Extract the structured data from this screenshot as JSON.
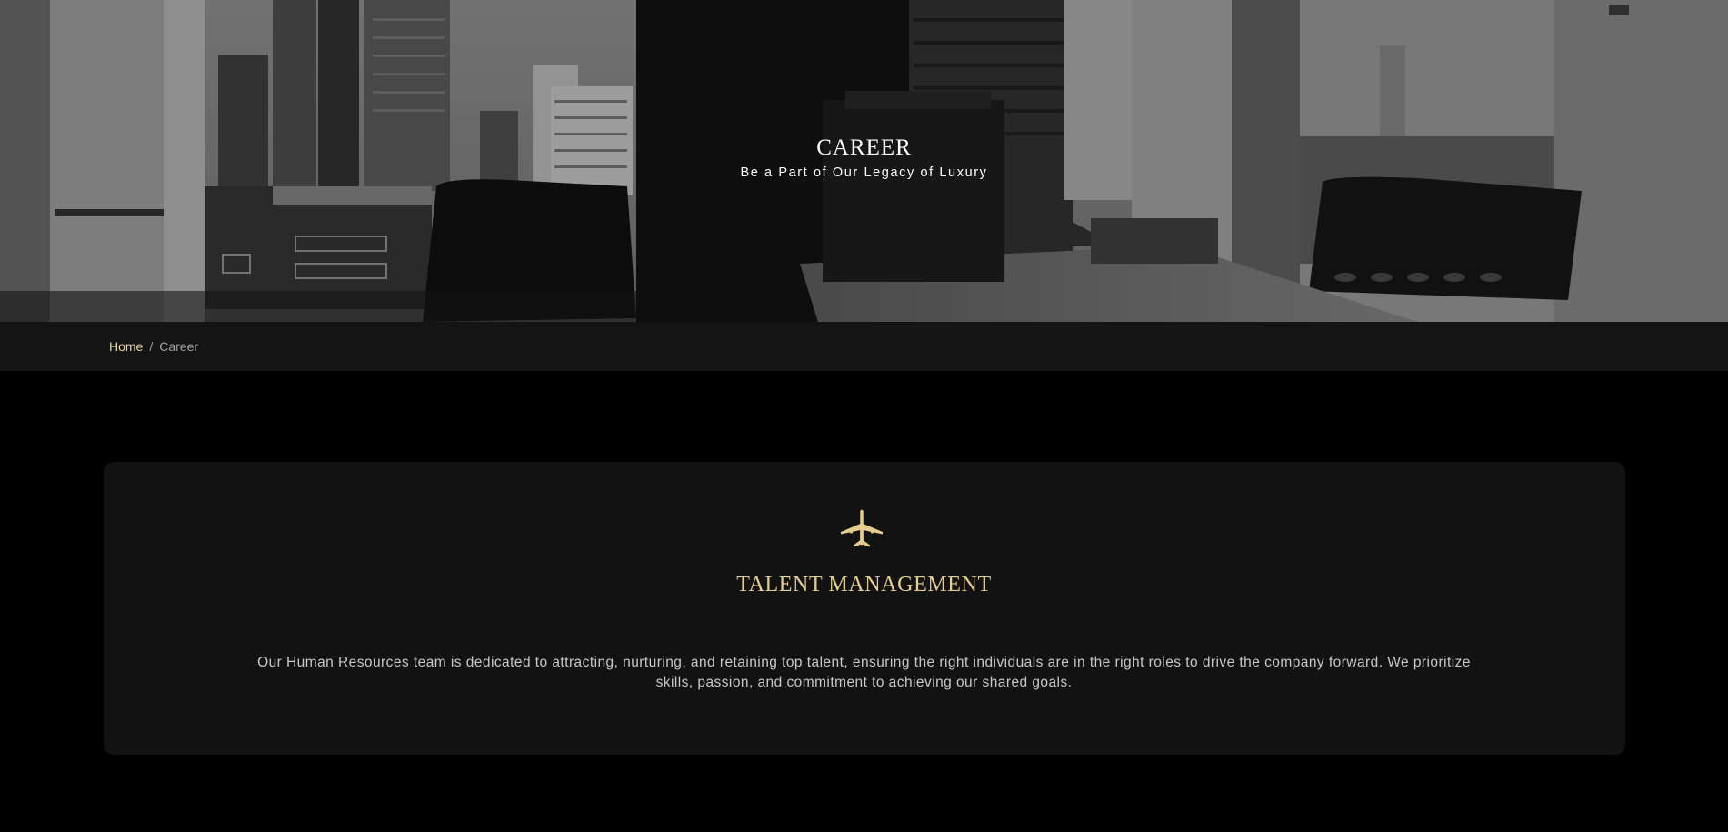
{
  "hero": {
    "title": "CAREER",
    "subtitle": "Be a Part of Our Legacy of Luxury",
    "background_image": "office-city-view-photo"
  },
  "breadcrumb": {
    "home_label": "Home",
    "separator": "/",
    "current_label": "Career"
  },
  "talent_card": {
    "icon": "airplane-icon",
    "title": "TALENT MANAGEMENT",
    "description": "Our Human Resources team is dedicated to attracting, nurturing, and retaining top talent, ensuring the right individuals are in the right roles to drive the company forward. We prioritize skills, passion, and commitment to achieving our shared goals."
  },
  "colors": {
    "page_background": "#000000",
    "breadcrumb_bar": "#141414",
    "card_background": "#121212",
    "accent_gold": "#e6cf8e",
    "body_text": "#c8c8c8"
  }
}
